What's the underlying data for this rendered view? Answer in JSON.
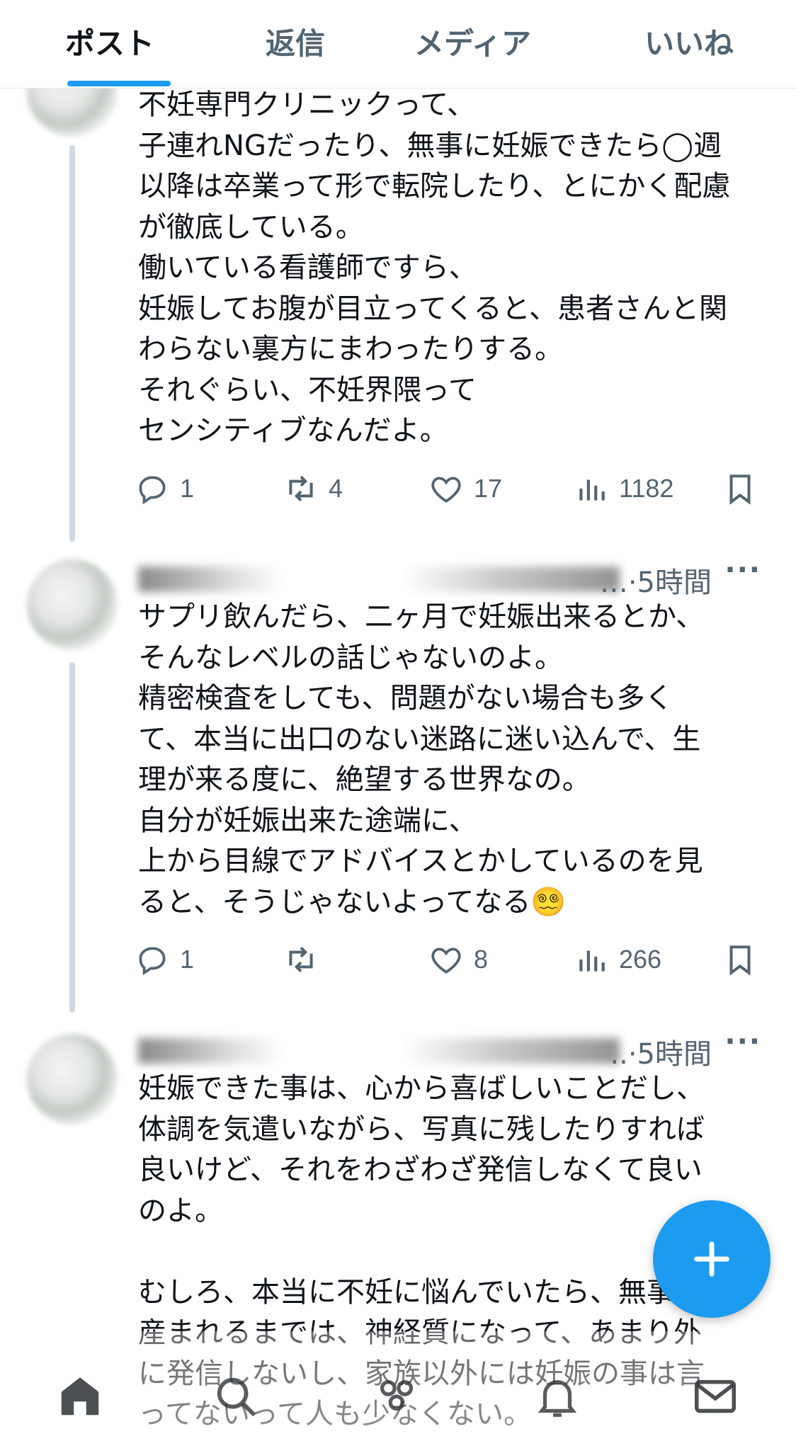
{
  "tabs": [
    {
      "label": "ポスト",
      "active": true
    },
    {
      "label": "返信"
    },
    {
      "label": "メディア"
    },
    {
      "label": "いいね"
    }
  ],
  "posts": [
    {
      "text": "不妊専門クリニックって、\n子連れNGだったり、無事に妊娠できたら◯週\n以降は卒業って形で転院したり、とにかく配慮\nが徹底している。\n働いている看護師ですら、\n妊娠してお腹が目立ってくると、患者さんと関\nわらない裏方にまわったりする。\nそれぐらい、不妊界隈って\nセンシティブなんだよ。",
      "replies": "1",
      "reposts": "4",
      "likes": "17",
      "views": "1182"
    },
    {
      "time": "…·5時間",
      "text": "サプリ飲んだら、二ヶ月で妊娠出来るとか、\nそんなレベルの話じゃないのよ。\n精密検査をしても、問題がない場合も多く\nて、本当に出口のない迷路に迷い込んで、生\n理が来る度に、絶望する世界なの。\n自分が妊娠出来た途端に、\n上から目線でアドバイスとかしているのを見\nると、そうじゃないよってなる😵‍💫",
      "replies": "1",
      "reposts": "",
      "likes": "8",
      "views": "266"
    },
    {
      "time": "..·5時間",
      "text": "妊娠できた事は、心から喜ばしいことだし、\n体調を気遣いながら、写真に残したりすれば\n良いけど、それをわざわざ発信しなくて良い\nのよ。\n\nむしろ、本当に不妊に悩んでいたら、無事\n産まれるまでは、神経質になって、あまり外\nに発信しないし、家族以外には妊娠の事は言\nってないって人も少なくない。"
    }
  ],
  "icons": {
    "reply": "reply-icon",
    "repost": "repost-icon",
    "like": "heart-icon",
    "views": "views-icon",
    "bookmark": "bookmark-icon",
    "more": "more-icon",
    "compose": "plus-icon",
    "nav": [
      "home-icon",
      "search-icon",
      "communities-icon",
      "notifications-icon",
      "messages-icon"
    ]
  },
  "colors": {
    "accent": "#1d9bf0",
    "text": "#0f1419",
    "secondary": "#536471"
  }
}
